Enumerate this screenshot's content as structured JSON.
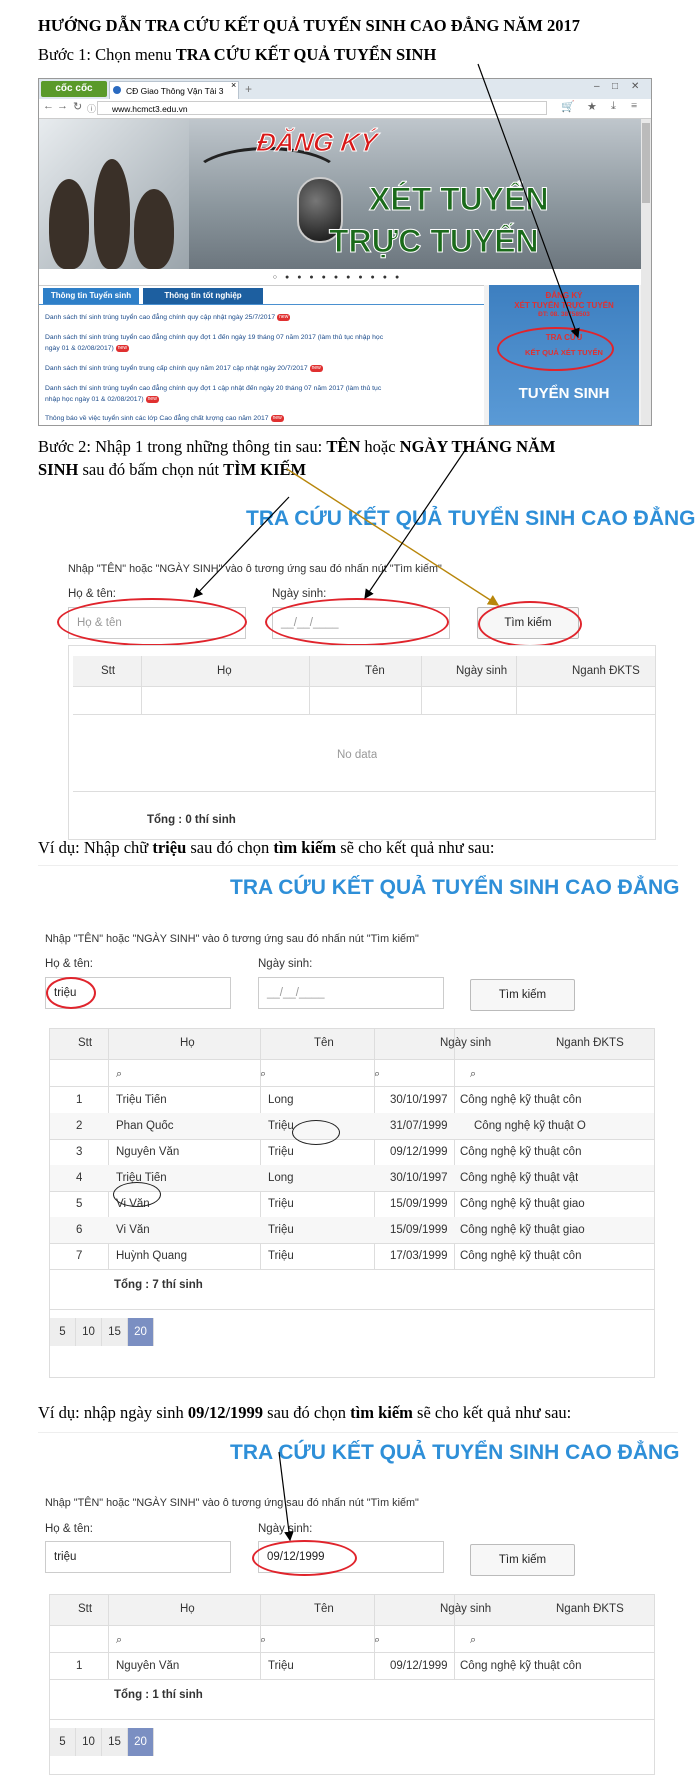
{
  "title": "HƯỚNG DẪN TRA CỨU KẾT QUẢ TUYỂN SINH CAO ĐẲNG NĂM 2017",
  "step1": {
    "prefix": "Bước 1: Chọn menu ",
    "bold": "TRA CỨU KẾT QUẢ TUYỂN SINH"
  },
  "browser": {
    "logo": "cốc cốc",
    "tab": "CĐ Giao Thông Vận Tải 3",
    "url": "www.hcmct3.edu.vn",
    "banner_line1": "ĐĂNG KÝ",
    "banner_line2": "XÉT TUYỂN",
    "banner_line3": "TRỰC TUYẾN",
    "tabs": [
      "Thông tin Tuyển sinh",
      "Thông tin tốt nghiệp"
    ],
    "news": [
      "Danh sách thí sinh trúng tuyển cao đẳng chính quy cập nhật ngày 25/7/2017",
      "Danh sách thí sinh trúng tuyển cao đẳng chính quy đợt 1 đến ngày 19 tháng 07 năm 2017 (làm thủ tục nhập học",
      "ngày 01 & 02/08/2017)",
      "Danh sách thí sinh trúng tuyển trung cấp chính quy năm 2017 cập nhật ngày 20/7/2017",
      "Danh sách thí sinh trúng tuyển cao đẳng chính quy đợt 1 cập nhật đến ngày 20 tháng 07 năm 2017 (làm thủ tục",
      "nhập học ngày 01 & 02/08/2017)",
      "Thông báo về việc tuyển sinh các lớp Cao đẳng chất lượng cao năm 2017"
    ],
    "new_badge": "new",
    "panel_top1": "ĐĂNG KÝ",
    "panel_top2": "XÉT TUYỂN TRỰC TUYẾN",
    "panel_phone": "ĐT: 08. 38758503",
    "panel_link1": "TRA CỨU",
    "panel_link2": "KẾT QUẢ XÉT TUYỂN",
    "panel_bottom": "TUYỂN SINH"
  },
  "step2": {
    "line1_prefix": "Bước 2: Nhập 1 trong những thông tin sau: ",
    "line1_bold1": "TÊN",
    "line1_mid": " hoặc ",
    "line1_bold2": "NGÀY THÁNG NĂM",
    "line2_bold": "SINH",
    "line2_mid": " sau đó bấm chọn nút ",
    "line2_bold2": "TÌM KIẾM"
  },
  "form": {
    "title": "TRA CỨU KẾT QUẢ TUYỂN SINH CAO ĐẲNG",
    "hint": "Nhập \"TÊN\" hoặc \"NGÀY SINH\" vào ô tương ứng sau đó nhấn nút \"Tìm kiếm\"",
    "name_label": "Họ & tên:",
    "dob_label": "Ngày sinh:",
    "name_placeholder": "Họ & tên",
    "dob_placeholder": "__/__/____",
    "dob_mask": "__/__/____",
    "search_button": "Tìm kiếm",
    "columns": [
      "Stt",
      "Họ",
      "Tên",
      "Ngày sinh",
      "Nganh ĐKTS"
    ],
    "no_data": "No data",
    "pages": [
      "5",
      "10",
      "15",
      "20"
    ]
  },
  "example1": {
    "text_prefix": "Ví dụ: Nhập chữ  ",
    "text_bold1": "triệu",
    "text_mid": " sau đó chọn ",
    "text_bold2": "tìm kiếm",
    "text_suffix": " sẽ cho kết quả như sau:",
    "name_value": "triệu",
    "total": "Tổng : 7 thí sinh",
    "rows": [
      [
        "1",
        "Triệu Tiến",
        "Long",
        "30/10/1997",
        "Công nghệ kỹ thuật côn"
      ],
      [
        "2",
        "Phan Quốc",
        "Triệu",
        "31/07/1999",
        "Công nghệ kỹ thuật Ô"
      ],
      [
        "3",
        "Nguyễn Văn",
        "Triệu",
        "09/12/1999",
        "Công nghệ kỹ thuật côn"
      ],
      [
        "4",
        "Triệu Tiến",
        "Long",
        "30/10/1997",
        "Công nghệ kỹ thuật vật"
      ],
      [
        "5",
        "Vi Văn",
        "Triệu",
        "15/09/1999",
        "Công nghệ kỹ thuật giao"
      ],
      [
        "6",
        "Vi Văn",
        "Triệu",
        "15/09/1999",
        "Công nghệ kỹ thuật giao"
      ],
      [
        "7",
        "Huỳnh Quang",
        "Triệu",
        "17/03/1999",
        "Công nghệ kỹ thuật côn"
      ]
    ]
  },
  "example2": {
    "text_prefix": "Ví dụ: nhập ngày sinh ",
    "text_bold1": "09/12/1999",
    "text_mid": " sau đó chọn ",
    "text_bold2": "tìm kiếm",
    "text_suffix": " sẽ cho kết quả như sau:",
    "name_value": "triệu",
    "dob_value": "09/12/1999",
    "total": "Tổng : 1 thí sinh",
    "rows": [
      [
        "1",
        "Nguyễn Văn",
        "Triệu",
        "09/12/1999",
        "Công nghệ kỹ thuật côn"
      ]
    ]
  },
  "total_empty": "Tổng : 0 thí sinh",
  "colors": {
    "title_blue": "#2e8fd8",
    "highlight_red": "#e0242c",
    "pager_active": "#7b8fc2"
  }
}
